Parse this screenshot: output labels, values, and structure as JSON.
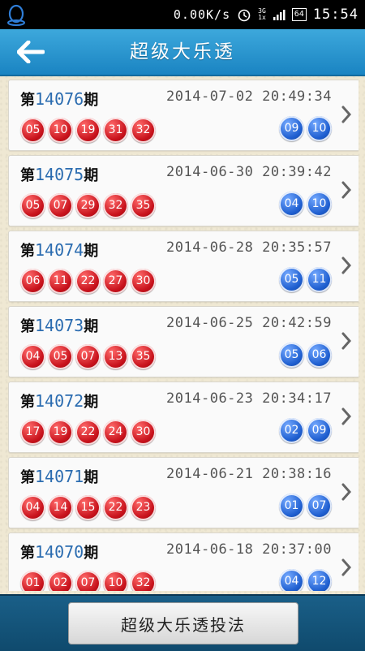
{
  "status_bar": {
    "network_speed": "0.00K/s",
    "signal_type_top": "3G",
    "signal_type_bottom": "1x",
    "battery": "64",
    "time": "15:54"
  },
  "header": {
    "title": "超级大乐透"
  },
  "draws": [
    {
      "prefix": "第",
      "issue": "14076",
      "suffix": "期",
      "date": "2014-07-02 20:49:34",
      "red": [
        "05",
        "10",
        "19",
        "31",
        "32"
      ],
      "blue": [
        "09",
        "10"
      ]
    },
    {
      "prefix": "第",
      "issue": "14075",
      "suffix": "期",
      "date": "2014-06-30 20:39:42",
      "red": [
        "05",
        "07",
        "29",
        "32",
        "35"
      ],
      "blue": [
        "04",
        "10"
      ]
    },
    {
      "prefix": "第",
      "issue": "14074",
      "suffix": "期",
      "date": "2014-06-28 20:35:57",
      "red": [
        "06",
        "11",
        "22",
        "27",
        "30"
      ],
      "blue": [
        "05",
        "11"
      ]
    },
    {
      "prefix": "第",
      "issue": "14073",
      "suffix": "期",
      "date": "2014-06-25 20:42:59",
      "red": [
        "04",
        "05",
        "07",
        "13",
        "35"
      ],
      "blue": [
        "05",
        "06"
      ]
    },
    {
      "prefix": "第",
      "issue": "14072",
      "suffix": "期",
      "date": "2014-06-23 20:34:17",
      "red": [
        "17",
        "19",
        "22",
        "24",
        "30"
      ],
      "blue": [
        "02",
        "09"
      ]
    },
    {
      "prefix": "第",
      "issue": "14071",
      "suffix": "期",
      "date": "2014-06-21 20:38:16",
      "red": [
        "04",
        "14",
        "15",
        "22",
        "23"
      ],
      "blue": [
        "01",
        "07"
      ]
    },
    {
      "prefix": "第",
      "issue": "14070",
      "suffix": "期",
      "date": "2014-06-18 20:37:00",
      "red": [
        "01",
        "02",
        "07",
        "10",
        "32"
      ],
      "blue": [
        "04",
        "12"
      ]
    }
  ],
  "footer": {
    "button_label": "超级大乐透投法"
  },
  "colors": {
    "header_blue": "#1a84c2",
    "red_ball": "#c8121c",
    "blue_ball": "#1f5fd0",
    "issue_number": "#2b6cb0"
  }
}
